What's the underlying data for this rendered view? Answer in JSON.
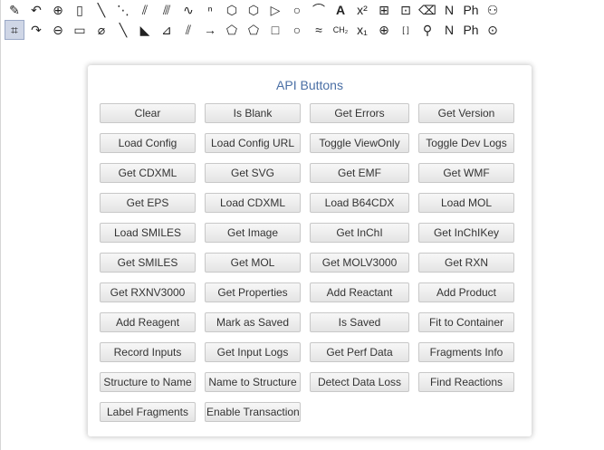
{
  "toolbar": {
    "row1": [
      {
        "icon": "lasso-icon",
        "glyph": "✎"
      },
      {
        "icon": "undo-icon",
        "glyph": "↶"
      },
      {
        "icon": "zoom-in-icon",
        "glyph": "⊕"
      },
      {
        "icon": "paste-icon",
        "glyph": "▯"
      },
      {
        "icon": "single-bond-icon",
        "glyph": "╲"
      },
      {
        "icon": "dashed-bond-icon",
        "glyph": "⋱"
      },
      {
        "icon": "hashed-bond-icon",
        "glyph": "⫽"
      },
      {
        "icon": "wavy-hashed-bond-icon",
        "glyph": "⫻"
      },
      {
        "icon": "wavy-bond-icon",
        "glyph": "∿"
      },
      {
        "icon": "chain-icon",
        "glyph": "ⁿ"
      },
      {
        "icon": "benzene-icon",
        "glyph": "⬡"
      },
      {
        "icon": "hexagon-icon",
        "glyph": "⬡"
      },
      {
        "icon": "triangle-icon",
        "glyph": "▷"
      },
      {
        "icon": "circle-icon",
        "glyph": "○"
      },
      {
        "icon": "bracket-shape-icon",
        "glyph": "⌒"
      },
      {
        "icon": "text-icon",
        "glyph": "A"
      },
      {
        "icon": "superscript-icon",
        "glyph": "x²"
      },
      {
        "icon": "table-icon",
        "glyph": "⊞"
      },
      {
        "icon": "grid-select-icon",
        "glyph": "⊡"
      },
      {
        "icon": "eraser-tool-icon",
        "glyph": "⌫"
      },
      {
        "icon": "name-structure-icon",
        "glyph": "N"
      },
      {
        "icon": "ph-structure-icon",
        "glyph": "Ph"
      },
      {
        "icon": "person-icon",
        "glyph": "⚇"
      }
    ],
    "row2": [
      {
        "icon": "marquee-select-icon",
        "glyph": "⌗"
      },
      {
        "icon": "redo-icon",
        "glyph": "↷"
      },
      {
        "icon": "zoom-out-icon",
        "glyph": "⊖"
      },
      {
        "icon": "copy-icon",
        "glyph": "▭"
      },
      {
        "icon": "eraser-icon",
        "glyph": "⌀"
      },
      {
        "icon": "bold-bond-icon",
        "glyph": "╲"
      },
      {
        "icon": "wedge-bond-icon",
        "glyph": "◣"
      },
      {
        "icon": "hashed-wedge-bond-icon",
        "glyph": "⊿"
      },
      {
        "icon": "double-bond-icon",
        "glyph": "⫽"
      },
      {
        "icon": "arrow-icon",
        "glyph": "→"
      },
      {
        "icon": "pentagon-icon",
        "glyph": "⬠"
      },
      {
        "icon": "pentagon-alt-icon",
        "glyph": "⬠"
      },
      {
        "icon": "square-icon",
        "glyph": "□"
      },
      {
        "icon": "ellipse-icon",
        "glyph": "○"
      },
      {
        "icon": "wavy-line-icon",
        "glyph": "≈"
      },
      {
        "icon": "formula-icon",
        "glyph": "CH₂"
      },
      {
        "icon": "subscript-icon",
        "glyph": "x₁"
      },
      {
        "icon": "ring-template-icon",
        "glyph": "⊕"
      },
      {
        "icon": "brackets-icon",
        "glyph": "[ ]"
      },
      {
        "icon": "rxn-icon",
        "glyph": "⚲"
      },
      {
        "icon": "name-icon",
        "glyph": "N"
      },
      {
        "icon": "ph-icon",
        "glyph": "Ph"
      },
      {
        "icon": "target-icon",
        "glyph": "⊙"
      }
    ]
  },
  "panel": {
    "title": "API Buttons",
    "buttons": [
      "Clear",
      "Is Blank",
      "Get Errors",
      "Get Version",
      "Load Config",
      "Load Config URL",
      "Toggle ViewOnly",
      "Toggle Dev Logs",
      "Get CDXML",
      "Get SVG",
      "Get EMF",
      "Get WMF",
      "Get EPS",
      "Load CDXML",
      "Load B64CDX",
      "Load MOL",
      "Load SMILES",
      "Get Image",
      "Get InChI",
      "Get InChIKey",
      "Get SMILES",
      "Get MOL",
      "Get MOLV3000",
      "Get RXN",
      "Get RXNV3000",
      "Get Properties",
      "Add Reactant",
      "Add Product",
      "Add Reagent",
      "Mark as Saved",
      "Is Saved",
      "Fit to Container",
      "Record Inputs",
      "Get Input Logs",
      "Get Perf Data",
      "Fragments Info",
      "Structure to Name",
      "Name to Structure",
      "Detect Data Loss",
      "Find Reactions",
      "Label Fragments",
      "Enable Transaction"
    ]
  }
}
